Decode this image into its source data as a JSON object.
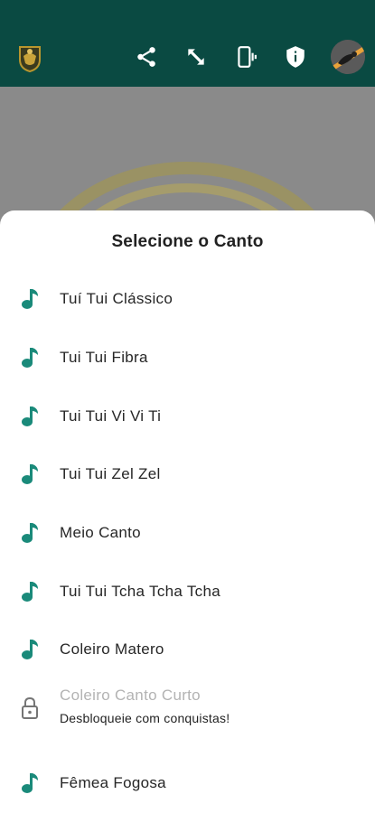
{
  "colors": {
    "accent": "#1a8a7a",
    "header": "#0a4a42",
    "locked_text": "#b3b3b3"
  },
  "header": {
    "icons": [
      "logo-icon",
      "share-icon",
      "expand-icon",
      "vibrate-phone-icon",
      "shield-info-icon",
      "avatar"
    ]
  },
  "sheet": {
    "title": "Selecione o Canto",
    "items": [
      {
        "label": "Tuí Tui Clássico",
        "icon": "music-note-icon"
      },
      {
        "label": "Tui Tui Fibra",
        "icon": "music-note-icon"
      },
      {
        "label": "Tui Tui Vi Vi Ti",
        "icon": "music-note-icon"
      },
      {
        "label": "Tui Tui Zel Zel",
        "icon": "music-note-icon"
      },
      {
        "label": "Meio Canto",
        "icon": "music-note-icon"
      },
      {
        "label": "Tui Tui Tcha Tcha Tcha",
        "icon": "music-note-icon"
      },
      {
        "label": "Coleiro Matero",
        "icon": "music-note-icon"
      },
      {
        "label": "Coleiro Canto Curto",
        "subtitle": "Desbloqueie com conquistas!",
        "icon": "lock-icon",
        "locked": true
      },
      {
        "label": "Fêmea Fogosa",
        "icon": "music-note-icon"
      }
    ]
  }
}
